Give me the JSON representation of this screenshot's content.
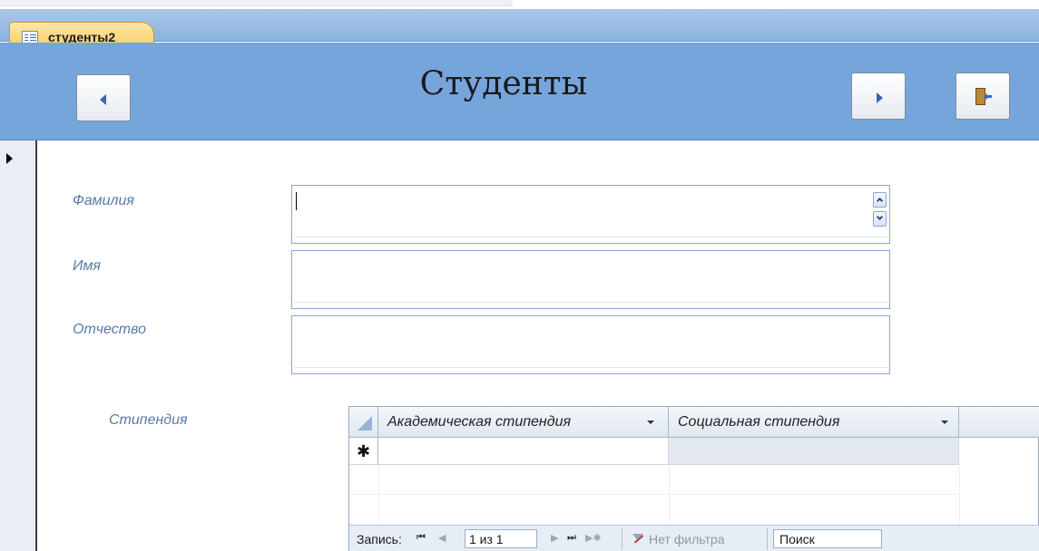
{
  "window": {
    "tab_title": "студенты2"
  },
  "header": {
    "title": "Студенты",
    "prev_icon": "left-triangle-icon",
    "next_icon": "right-triangle-icon",
    "close_icon": "exit-door-icon"
  },
  "form": {
    "fields": [
      {
        "label": "Фамилия",
        "value": ""
      },
      {
        "label": "Имя",
        "value": ""
      },
      {
        "label": "Отчество",
        "value": ""
      }
    ],
    "subform_label": "Стипендия"
  },
  "subform": {
    "columns": [
      "Академическая стипендия",
      "Социальная стипендия"
    ],
    "new_row_marker": "✱",
    "rows": []
  },
  "record_nav": {
    "label": "Запись:",
    "first": "⏮",
    "prev": "◀",
    "position": "1 из 1",
    "next": "▶",
    "last": "⏭",
    "new": "▶✱",
    "filter_text": "Нет фильтра",
    "search_text": "Поиск"
  }
}
